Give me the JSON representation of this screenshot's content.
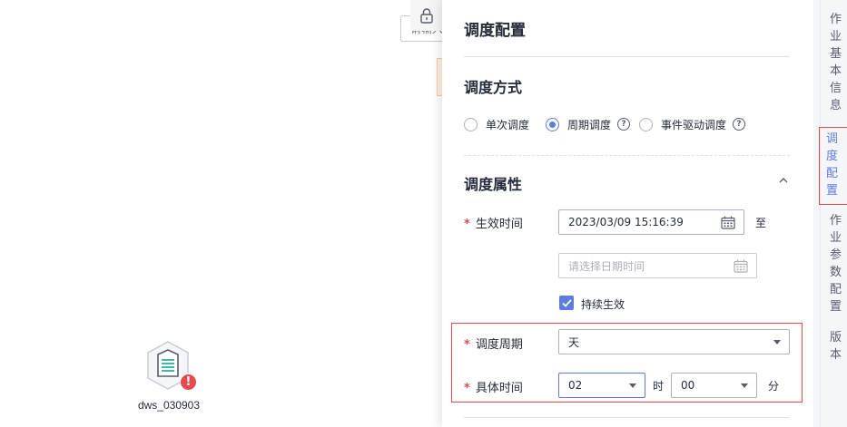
{
  "canvas": {
    "search_placeholder": "请输入关键字",
    "node": {
      "name": "dws_030903",
      "badge": "!"
    }
  },
  "panel": {
    "title": "调度配置",
    "schedule_method": {
      "title": "调度方式",
      "options": [
        {
          "label": "单次调度",
          "checked": false,
          "help": false
        },
        {
          "label": "周期调度",
          "checked": true,
          "help": true
        },
        {
          "label": "事件驱动调度",
          "checked": false,
          "help": true
        }
      ]
    },
    "schedule_props": {
      "title": "调度属性",
      "effective_time": {
        "label": "生效时间",
        "start_value": "2023/03/09 15:16:39",
        "to_text": "至",
        "end_placeholder": "请选择日期时间"
      },
      "continuous": {
        "label": "持续生效",
        "checked": true
      },
      "period": {
        "label": "调度周期",
        "value": "天"
      },
      "specific_time": {
        "label": "具体时间",
        "hour": "02",
        "hour_unit": "时",
        "minute": "00",
        "minute_unit": "分"
      }
    }
  },
  "nav": {
    "items": [
      {
        "label": "作业基本信息",
        "active": false
      },
      {
        "label": "调度配置",
        "active": true
      },
      {
        "label": "作业参数配置",
        "active": false
      },
      {
        "label": "版本",
        "active": false
      }
    ]
  },
  "colors": {
    "accent": "#5e7ce0",
    "required": "#e5484d",
    "text": "#252b3a",
    "placeholder": "#adb0b8",
    "node_green": "#3fbaa7"
  }
}
